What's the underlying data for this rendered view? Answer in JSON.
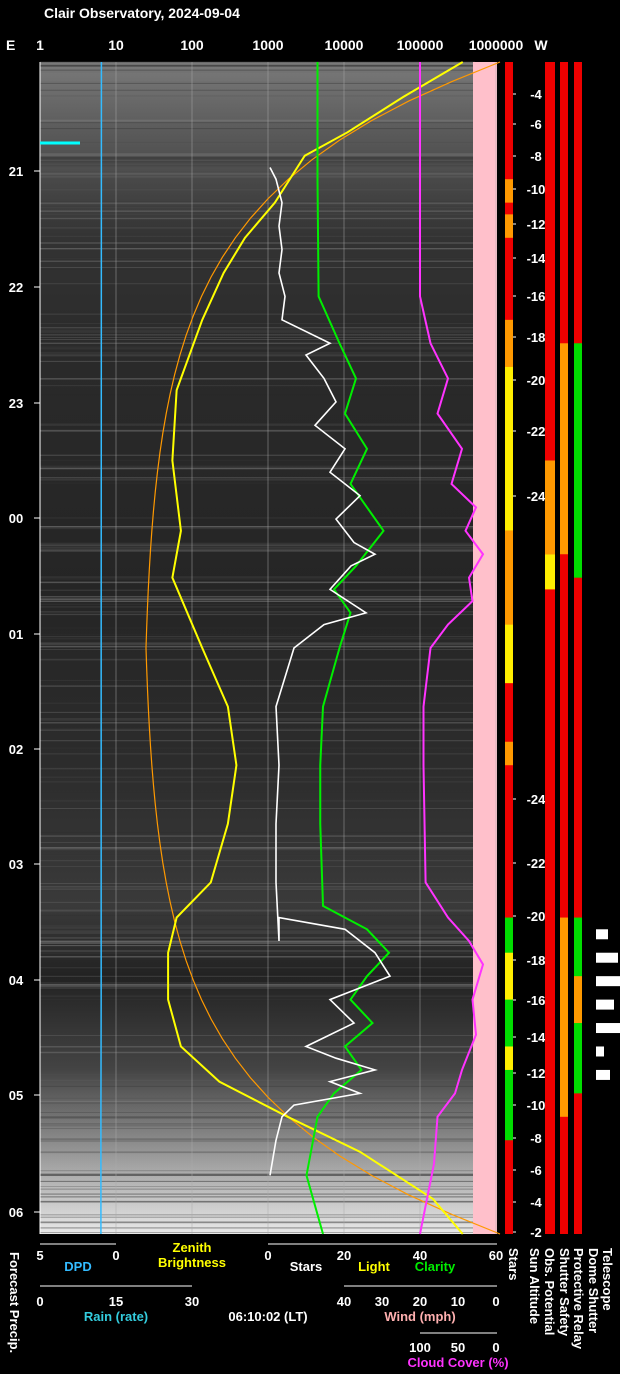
{
  "chart_data": {
    "type": "line",
    "title": "Clair Observatory, 2024-09-04",
    "timestamp": "06:10:02 (LT)",
    "top_axis": {
      "left_label": "E",
      "right_label": "W",
      "ticks": [
        "1",
        "10",
        "100",
        "1000",
        "10000",
        "100000",
        "1000000"
      ]
    },
    "time_axis": {
      "ticks": [
        "21",
        "22",
        "23",
        "00",
        "01",
        "02",
        "03",
        "04",
        "05",
        "06"
      ]
    },
    "sun_altitude_ticks": [
      "-4",
      "-6",
      "-8",
      "-10",
      "-12",
      "-14",
      "-16",
      "-18",
      "-20",
      "-22",
      "-24",
      "-24",
      "-22",
      "-20",
      "-18",
      "-16",
      "-14",
      "-12",
      "-10",
      "-8",
      "-6",
      "-4",
      "-2"
    ],
    "bottom_axes": {
      "dpd": {
        "label": "DPD",
        "ticks": [
          "5",
          "0"
        ],
        "color": "#33bbff"
      },
      "zenith": {
        "label_line1": "Zenith",
        "label_line2": "Brightness",
        "color": "#ffff00"
      },
      "stars_light_clarity": {
        "ticks": [
          "0",
          "20",
          "40",
          "60"
        ],
        "stars_label": "Stars",
        "light_label": "Light",
        "clarity_label": "Clarity"
      },
      "rain": {
        "label": "Rain (rate)",
        "ticks": [
          "0",
          "15",
          "30"
        ],
        "color": "#33ccdd"
      },
      "wind": {
        "label": "Wind (mph)",
        "ticks": [
          "40",
          "30",
          "20",
          "10",
          "0"
        ],
        "color": "#ffb0b0"
      },
      "cloud": {
        "label": "Cloud Cover (%)",
        "ticks": [
          "100",
          "50",
          "0"
        ],
        "color": "#ff33ff"
      },
      "forecast_label": "Forecast Precip."
    },
    "status_columns": [
      "Stars",
      "Sun Altitude",
      "Obs. Potential",
      "Shutter Safety",
      "Protective Relay",
      "Dome Shutter",
      "Telescope"
    ],
    "series": [
      {
        "name": "Stars",
        "color": "#ffffff",
        "values": [
          [
            0.09,
            0
          ],
          [
            0.1,
            2
          ],
          [
            0.12,
            4
          ],
          [
            0.14,
            3
          ],
          [
            0.16,
            4
          ],
          [
            0.18,
            3
          ],
          [
            0.2,
            5
          ],
          [
            0.22,
            4
          ],
          [
            0.24,
            20
          ],
          [
            0.25,
            12
          ],
          [
            0.27,
            18
          ],
          [
            0.29,
            22
          ],
          [
            0.31,
            15
          ],
          [
            0.33,
            25
          ],
          [
            0.35,
            20
          ],
          [
            0.37,
            30
          ],
          [
            0.39,
            22
          ],
          [
            0.41,
            28
          ],
          [
            0.42,
            35
          ],
          [
            0.43,
            27
          ],
          [
            0.45,
            20
          ],
          [
            0.47,
            32
          ],
          [
            0.48,
            18
          ],
          [
            0.5,
            8
          ],
          [
            0.55,
            2
          ],
          [
            0.6,
            3
          ],
          [
            0.65,
            2
          ],
          [
            0.7,
            2
          ],
          [
            0.75,
            3
          ],
          [
            0.73,
            3
          ],
          [
            0.74,
            25
          ],
          [
            0.76,
            35
          ],
          [
            0.78,
            40
          ],
          [
            0.79,
            30
          ],
          [
            0.8,
            20
          ],
          [
            0.82,
            28
          ],
          [
            0.84,
            12
          ],
          [
            0.85,
            22
          ],
          [
            0.86,
            35
          ],
          [
            0.87,
            20
          ],
          [
            0.88,
            30
          ],
          [
            0.89,
            8
          ],
          [
            0.9,
            4
          ],
          [
            0.92,
            2
          ],
          [
            0.95,
            0
          ]
        ]
      },
      {
        "name": "Light",
        "color": "#ffff00",
        "values": [
          [
            0.0,
            0.99
          ],
          [
            0.03,
            0.85
          ],
          [
            0.06,
            0.72
          ],
          [
            0.08,
            0.62
          ],
          [
            0.12,
            0.55
          ],
          [
            0.15,
            0.48
          ],
          [
            0.18,
            0.43
          ],
          [
            0.22,
            0.38
          ],
          [
            0.28,
            0.32
          ],
          [
            0.34,
            0.31
          ],
          [
            0.4,
            0.33
          ],
          [
            0.44,
            0.31
          ],
          [
            0.5,
            0.38
          ],
          [
            0.55,
            0.44
          ],
          [
            0.6,
            0.46
          ],
          [
            0.65,
            0.44
          ],
          [
            0.7,
            0.4
          ],
          [
            0.73,
            0.32
          ],
          [
            0.76,
            0.3
          ],
          [
            0.8,
            0.3
          ],
          [
            0.84,
            0.33
          ],
          [
            0.87,
            0.42
          ],
          [
            0.9,
            0.58
          ],
          [
            0.93,
            0.75
          ],
          [
            0.97,
            0.92
          ],
          [
            1.0,
            0.99
          ]
        ]
      },
      {
        "name": "Clarity",
        "color": "#00ee00",
        "values": [
          [
            0.0,
            0.9
          ],
          [
            0.1,
            0.9
          ],
          [
            0.2,
            0.92
          ],
          [
            0.24,
            1.3
          ],
          [
            0.27,
            1.6
          ],
          [
            0.3,
            1.4
          ],
          [
            0.33,
            1.8
          ],
          [
            0.36,
            1.5
          ],
          [
            0.4,
            2.1
          ],
          [
            0.43,
            1.6
          ],
          [
            0.45,
            1.2
          ],
          [
            0.47,
            1.5
          ],
          [
            0.5,
            1.3
          ],
          [
            0.55,
            1.0
          ],
          [
            0.6,
            0.95
          ],
          [
            0.65,
            0.95
          ],
          [
            0.72,
            1.0
          ],
          [
            0.74,
            1.8
          ],
          [
            0.76,
            2.2
          ],
          [
            0.78,
            1.8
          ],
          [
            0.8,
            1.5
          ],
          [
            0.82,
            1.9
          ],
          [
            0.84,
            1.4
          ],
          [
            0.86,
            1.7
          ],
          [
            0.88,
            1.2
          ],
          [
            0.9,
            0.9
          ],
          [
            0.95,
            0.7
          ],
          [
            1.0,
            1.0
          ]
        ]
      },
      {
        "name": "Cloud",
        "color": "#ff33ff",
        "values": [
          [
            0.0,
            100
          ],
          [
            0.2,
            100
          ],
          [
            0.24,
            85
          ],
          [
            0.27,
            60
          ],
          [
            0.3,
            75
          ],
          [
            0.33,
            40
          ],
          [
            0.36,
            55
          ],
          [
            0.38,
            20
          ],
          [
            0.4,
            35
          ],
          [
            0.42,
            10
          ],
          [
            0.44,
            30
          ],
          [
            0.46,
            25
          ],
          [
            0.48,
            60
          ],
          [
            0.5,
            85
          ],
          [
            0.55,
            95
          ],
          [
            0.6,
            95
          ],
          [
            0.7,
            92
          ],
          [
            0.73,
            60
          ],
          [
            0.75,
            30
          ],
          [
            0.77,
            10
          ],
          [
            0.8,
            25
          ],
          [
            0.83,
            20
          ],
          [
            0.86,
            40
          ],
          [
            0.88,
            50
          ],
          [
            0.9,
            75
          ],
          [
            0.94,
            80
          ],
          [
            0.97,
            90
          ],
          [
            1.0,
            100
          ]
        ]
      },
      {
        "name": "DPD",
        "color": "#33bbff",
        "values": [
          [
            0.0,
            2.0
          ],
          [
            0.3,
            1.9
          ],
          [
            0.5,
            1.8
          ],
          [
            0.8,
            1.8
          ],
          [
            0.9,
            1.6
          ],
          [
            1.0,
            1.6
          ]
        ]
      }
    ],
    "xlabel": "",
    "ylabel": ""
  }
}
